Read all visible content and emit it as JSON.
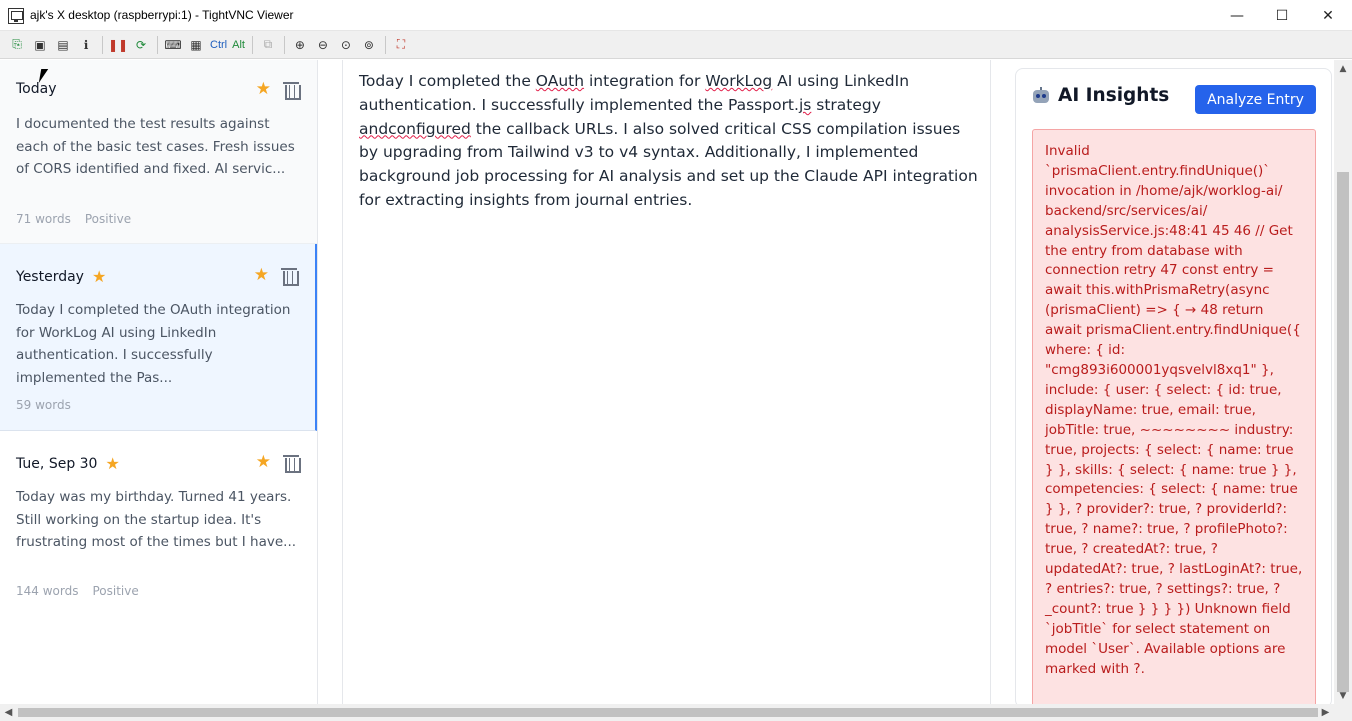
{
  "window": {
    "title": "ajk's X desktop (raspberrypi:1) - TightVNC Viewer",
    "minimize_glyph": "—",
    "maximize_glyph": "☐",
    "close_glyph": "✕"
  },
  "toolbar": {
    "ctrl_label": "Ctrl",
    "alt_label": "Alt",
    "icons": [
      "new-connection-icon",
      "save-icon",
      "options-icon",
      "connection-info-icon",
      "pause-icon",
      "refresh-icon",
      "ctrl-alt-del-icon",
      "ctrl-esc-icon",
      "ctrl-key-icon",
      "alt-key-icon",
      "copy-icon",
      "zoom-in-icon",
      "zoom-out-icon",
      "zoom-100-icon",
      "zoom-auto-icon",
      "fullscreen-icon"
    ]
  },
  "sidebar": {
    "entries": [
      {
        "date": "Today",
        "favorite_marker": false,
        "excerpt": "I documented the test results against each of the basic test cases. Fresh issues of CORS identified and fixed. AI servic...",
        "words": "71 words",
        "sentiment": "Positive"
      },
      {
        "date": "Yesterday",
        "favorite_marker": true,
        "excerpt": "Today I completed the OAuth integration for WorkLog AI using LinkedIn authentication. I successfully implemented the Pas...",
        "words": "59 words",
        "sentiment": ""
      },
      {
        "date": "Tue, Sep 30",
        "favorite_marker": true,
        "excerpt": "Today was my birthday. Turned 41 years. Still working on the startup idea. It's frustrating most of the times but I have...",
        "words": "144 words",
        "sentiment": "Positive"
      }
    ]
  },
  "editor": {
    "t1": "Today I completed the ",
    "t2": "OAuth",
    "t3": " integration for ",
    "t4": "WorkLog",
    "t5": " AI using LinkedIn authentication. I successfully implemented the Passport.",
    "t6": "js",
    "t7": " strategy ",
    "t8": "andconfigured",
    "t9": " the callback URLs. I also solved critical CSS compilation issues by upgrading from Tailwind v3 to v4 syntax. Additionally, I implemented background job processing for AI analysis and set up the Claude API integration for extracting insights from journal entries."
  },
  "insights": {
    "title": "AI Insights",
    "analyze_label": "Analyze Entry",
    "error_text": "Invalid `prismaClient.entry.findUnique()` invocation in /home/ajk/worklog-ai/ backend/src/services/ai/ analysisService.js:48:41 45 46 // Get the entry from database with connection retry 47 const entry = await this.withPrismaRetry(async (prismaClient) => { → 48 return await prismaClient.entry.findUnique({ where: { id: \"cmg893i600001yqsvelvl8xq1\" }, include: { user: { select: { id: true, displayName: true, email: true, jobTitle: true, ~~~~~~~~ industry: true, projects: { select: { name: true } }, skills: { select: { name: true } }, competencies: { select: { name: true } }, ? provider?: true, ? providerId?: true, ? name?: true, ? profilePhoto?: true, ? createdAt?: true, ? updatedAt?: true, ? lastLoginAt?: true, ? entries?: true, ? settings?: true, ? _count?: true } } } }) Unknown field `jobTitle` for select statement on model `User`. Available options are marked with ?."
  },
  "colors": {
    "accent": "#2563eb",
    "star": "#f5a623",
    "selected_bg": "#eff6ff",
    "selected_border": "#3b82f6",
    "error_bg": "#fde2e2",
    "error_text": "#b91c1c"
  }
}
